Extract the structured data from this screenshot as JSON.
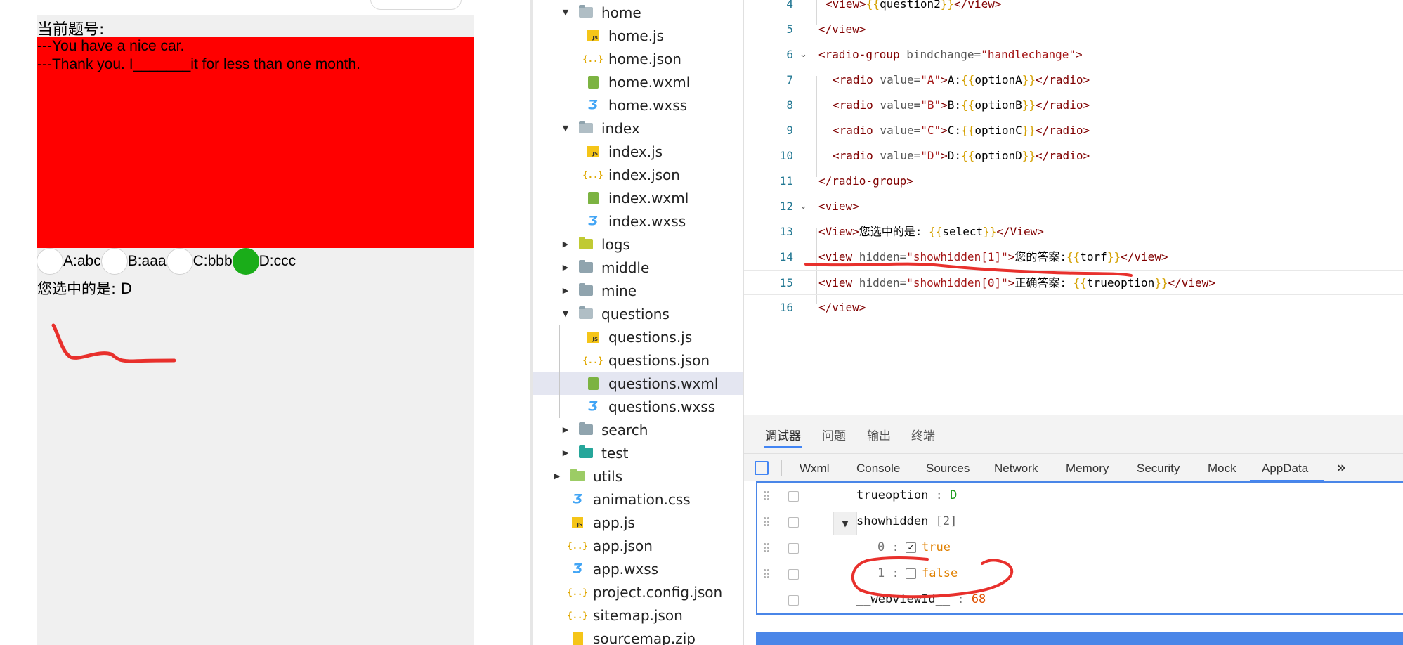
{
  "simulator": {
    "page_title": "当前题号:",
    "question_line1": "---You have a nice car.",
    "question_line2": "---Thank you. I_______it for less than one month.",
    "options": [
      {
        "label": "A:abc",
        "checked": false
      },
      {
        "label": "B:aaa",
        "checked": false
      },
      {
        "label": "C:bbb",
        "checked": false
      },
      {
        "label": "D:ccc",
        "checked": true
      }
    ],
    "selected_text": "您选中的是:  D"
  },
  "file_tree": {
    "items": [
      {
        "label": "home",
        "type": "folder-open"
      },
      {
        "label": "home.js",
        "type": "js"
      },
      {
        "label": "home.json",
        "type": "json"
      },
      {
        "label": "home.wxml",
        "type": "wxml"
      },
      {
        "label": "home.wxss",
        "type": "wxss"
      },
      {
        "label": "index",
        "type": "folder-open"
      },
      {
        "label": "index.js",
        "type": "js"
      },
      {
        "label": "index.json",
        "type": "json"
      },
      {
        "label": "index.wxml",
        "type": "wxml"
      },
      {
        "label": "index.wxss",
        "type": "wxss"
      },
      {
        "label": "logs",
        "type": "folder-closed"
      },
      {
        "label": "middle",
        "type": "folder-closed"
      },
      {
        "label": "mine",
        "type": "folder-closed"
      },
      {
        "label": "questions",
        "type": "folder-open"
      },
      {
        "label": "questions.js",
        "type": "js"
      },
      {
        "label": "questions.json",
        "type": "json"
      },
      {
        "label": "questions.wxml",
        "type": "wxml",
        "selected": true
      },
      {
        "label": "questions.wxss",
        "type": "wxss"
      },
      {
        "label": "search",
        "type": "folder-closed"
      },
      {
        "label": "test",
        "type": "folder-closed"
      },
      {
        "label": "utils",
        "type": "folder-closed"
      },
      {
        "label": "animation.css",
        "type": "wxss"
      },
      {
        "label": "app.js",
        "type": "js"
      },
      {
        "label": "app.json",
        "type": "json"
      },
      {
        "label": "app.wxss",
        "type": "wxss"
      },
      {
        "label": "project.config.json",
        "type": "json"
      },
      {
        "label": "sitemap.json",
        "type": "json"
      },
      {
        "label": "sourcemap.zip",
        "type": "zip"
      }
    ]
  },
  "editor": {
    "lines": [
      {
        "n": "4"
      },
      {
        "n": "5"
      },
      {
        "n": "6"
      },
      {
        "n": "7"
      },
      {
        "n": "8"
      },
      {
        "n": "9"
      },
      {
        "n": "10"
      },
      {
        "n": "11"
      },
      {
        "n": "12"
      },
      {
        "n": "13"
      },
      {
        "n": "14"
      },
      {
        "n": "15"
      },
      {
        "n": "16"
      }
    ],
    "tokens": {
      "view_open": "<view>",
      "view_close": "</view>",
      "View_open": "<View>",
      "View_close": "</View>",
      "question2": "question2",
      "radio_group_open": "<radio-group",
      "radio_group_close": "</radio-group>",
      "bindchange_attr": " bindchange=",
      "handlechange": "\"handlechange\"",
      "gt": ">",
      "radio_open": "<radio",
      "radio_close": "</radio>",
      "value_attr": " value=",
      "val_A": "\"A\"",
      "val_B": "\"B\"",
      "val_C": "\"C\"",
      "val_D": "\"D\"",
      "text_A": "A:",
      "text_B": "B:",
      "text_C": "C:",
      "text_D": "D:",
      "optionA": "optionA",
      "optionB": "optionB",
      "optionC": "optionC",
      "optionD": "optionD",
      "ob": "{{",
      "cb": "}}",
      "select_text": "您选中的是: ",
      "select": "select",
      "view_tag": "<view",
      "hidden_attr": " hidden=",
      "showhidden1": "\"showhidden[1]\"",
      "showhidden0": "\"showhidden[0]\"",
      "answer_text": "您的答案:",
      "torf": "torf",
      "correct_text": "正确答案: ",
      "trueoption": "trueoption"
    }
  },
  "debugger": {
    "top_tabs": [
      "调试器",
      "问题",
      "输出",
      "终端"
    ],
    "panel_tabs": [
      "Wxml",
      "Console",
      "Sources",
      "Network",
      "Memory",
      "Security",
      "Mock",
      "AppData"
    ],
    "appdata": {
      "trueoption_key": "trueoption",
      "trueoption_val": "D",
      "showhidden_key": "showhidden",
      "showhidden_count": "[2]",
      "item0_idx": "0",
      "item0_val": "true",
      "item1_idx": "1",
      "item1_val": "false",
      "webview_key": "__webviewId__",
      "webview_val": "68",
      "colon": ":"
    }
  },
  "colors": {
    "question_bg": "#ff0000",
    "radio_checked": "#1aad19",
    "annotation": "#e8302c",
    "accent": "#4285f4"
  }
}
